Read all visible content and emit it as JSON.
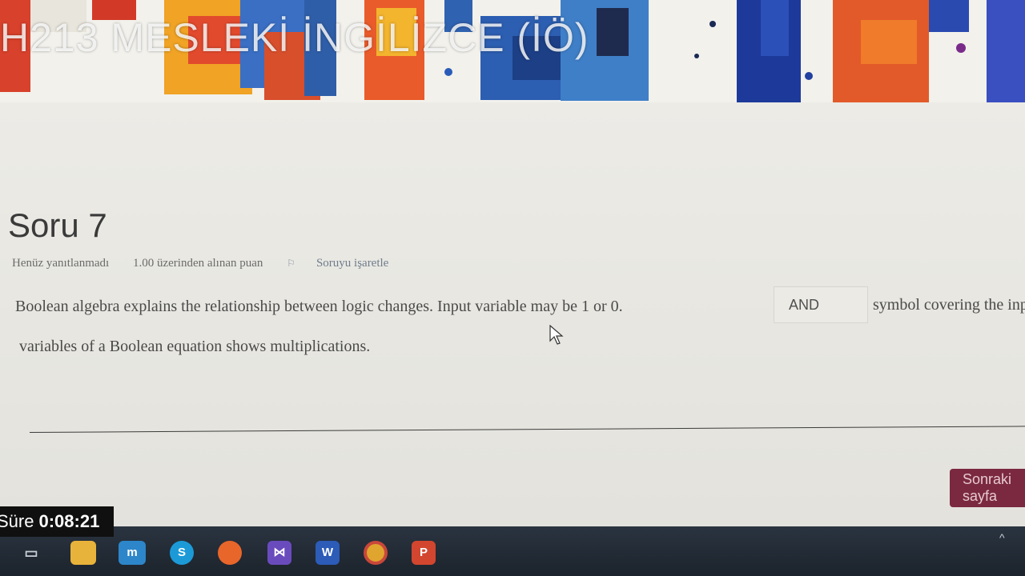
{
  "banner": {
    "course_title": "H213 MESLEKİ İNGİLİZCE (İÖ)"
  },
  "question": {
    "title": "Soru 7",
    "status": "Henüz yanıtlanmadı",
    "points": "1.00 üzerinden alınan puan",
    "flag_label": "Soruyu işaretle",
    "text_line1_before": "Boolean algebra explains the relationship between logic changes. Input variable may be 1 or 0.",
    "answer_value": "AND",
    "text_line1_after": "symbol covering the input",
    "text_line2": "variables of a Boolean equation shows multiplications."
  },
  "navigation": {
    "next_label": "Sonraki sayfa"
  },
  "timer": {
    "label": "Süre",
    "value": "0:08:21"
  },
  "taskbar": {
    "icons": [
      "task-view-icon",
      "file-explorer-icon",
      "moodle-icon",
      "skype-icon",
      "firefox-icon",
      "visual-studio-icon",
      "word-icon",
      "chrome-icon",
      "powerpoint-icon"
    ],
    "tray_chevron": "^"
  },
  "colors": {
    "next_button": "#7a2940",
    "link": "#6f7d8c",
    "background": "#e4e3dd"
  }
}
